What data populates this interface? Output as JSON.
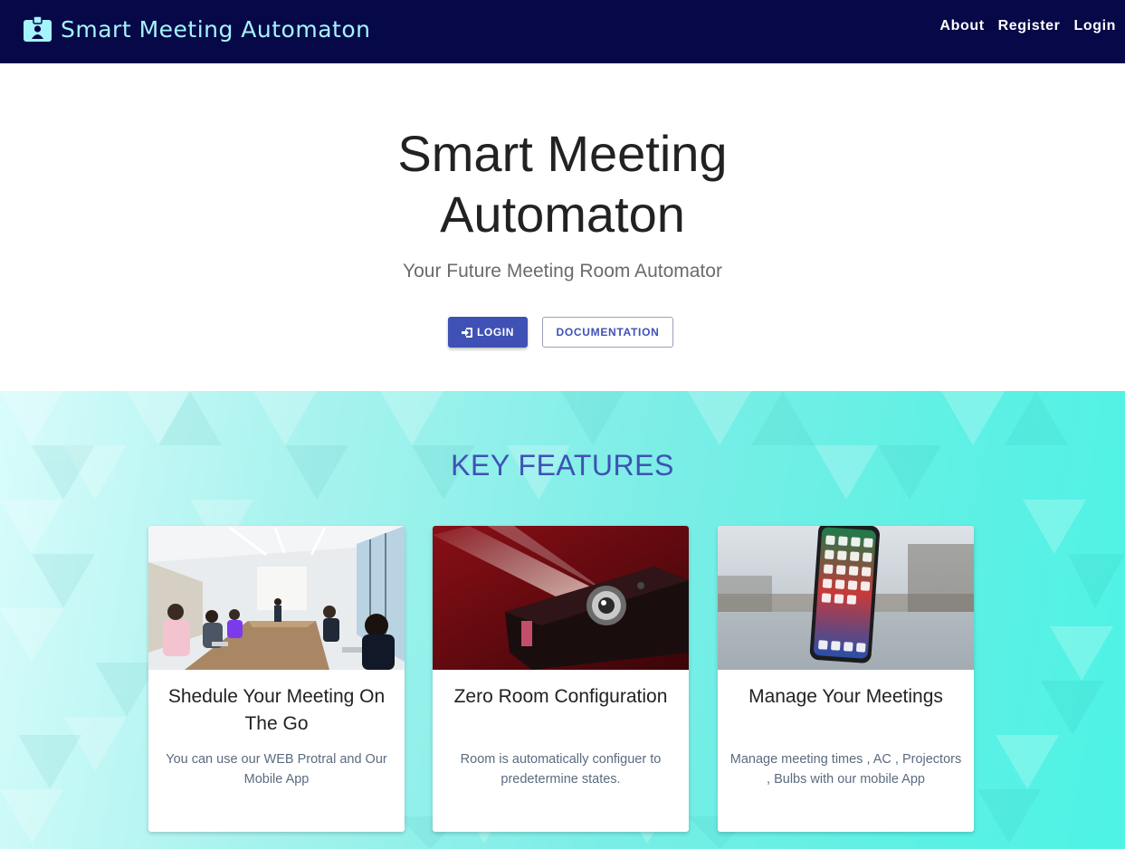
{
  "navbar": {
    "brand": "Smart Meeting Automaton",
    "brand_icon": "id-badge-icon",
    "links": [
      "About",
      "Register",
      "Login"
    ]
  },
  "hero": {
    "title_line1": "Smart Meeting",
    "title_line2": "Automaton",
    "subtitle": "Your Future Meeting Room Automator",
    "login_label": "LOGIN",
    "login_icon": "login-icon",
    "docs_label": "DOCUMENTATION"
  },
  "features": {
    "title": "KEY FEATURES",
    "cards": [
      {
        "title": "Shedule Your Meeting On The Go",
        "text": "You can use our WEB Protral and Our Mobile App",
        "image": "conference-room-photo"
      },
      {
        "title": "Zero Room Configuration",
        "text": "Room is automatically configuer to predetermine states.",
        "image": "projector-photo"
      },
      {
        "title": "Manage Your Meetings",
        "text": "Manage meeting times , AC , Projectors , Bulbs with our mobile App",
        "image": "smartphone-photo"
      }
    ]
  },
  "colors": {
    "navbar": "#070848",
    "brand_text": "#a5f3fc",
    "primary": "#3f51b5",
    "features_bg": "#5ff0e4"
  }
}
